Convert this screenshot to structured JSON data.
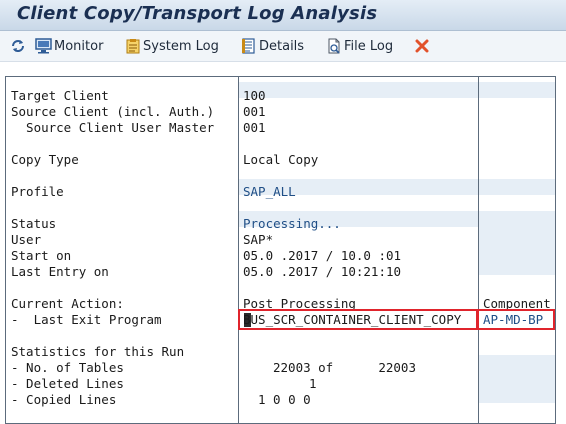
{
  "window": {
    "title": "Client Copy/Transport Log Analysis"
  },
  "toolbar": {
    "refresh_icon": "refresh-icon",
    "monitor_label": "Monitor",
    "system_log_label": "System Log",
    "details_label": "Details",
    "file_log_label": "File Log",
    "close_icon": "cancel-x-icon"
  },
  "rows": {
    "target_client_label": "Target Client",
    "target_client_value": "100",
    "source_client_label": "Source Client (incl. Auth.)",
    "source_client_value": "001",
    "source_user_master_label": "  Source Client User Master",
    "source_user_master_value": "001",
    "copy_type_label": "Copy Type",
    "copy_type_value": "Local Copy",
    "profile_label": "Profile",
    "profile_value": "SAP_ALL",
    "status_label": "Status",
    "status_value": "Processing...",
    "user_label": "User",
    "user_value": "SAP*",
    "start_on_label": "Start on",
    "start_on_value": "05.0 .2017 / 10.0 :01",
    "last_entry_label": "Last Entry on",
    "last_entry_value": "05.0 .2017 / 10:21:10",
    "current_action_label": "Current Action:",
    "current_action_value": "Post Processing",
    "component_header": "Component",
    "last_exit_label": "-  Last Exit Program",
    "last_exit_value": "BUS_SCR_CONTAINER_CLIENT_COPY",
    "last_exit_component": "AP-MD-BP",
    "stats_label": "Statistics for this Run",
    "tables_label": "- No. of Tables",
    "tables_value": "22003 of      22003",
    "deleted_label": "- Deleted Lines",
    "deleted_value": "1",
    "copied_label": "- Copied Lines",
    "copied_value": "1 0 0 0"
  }
}
